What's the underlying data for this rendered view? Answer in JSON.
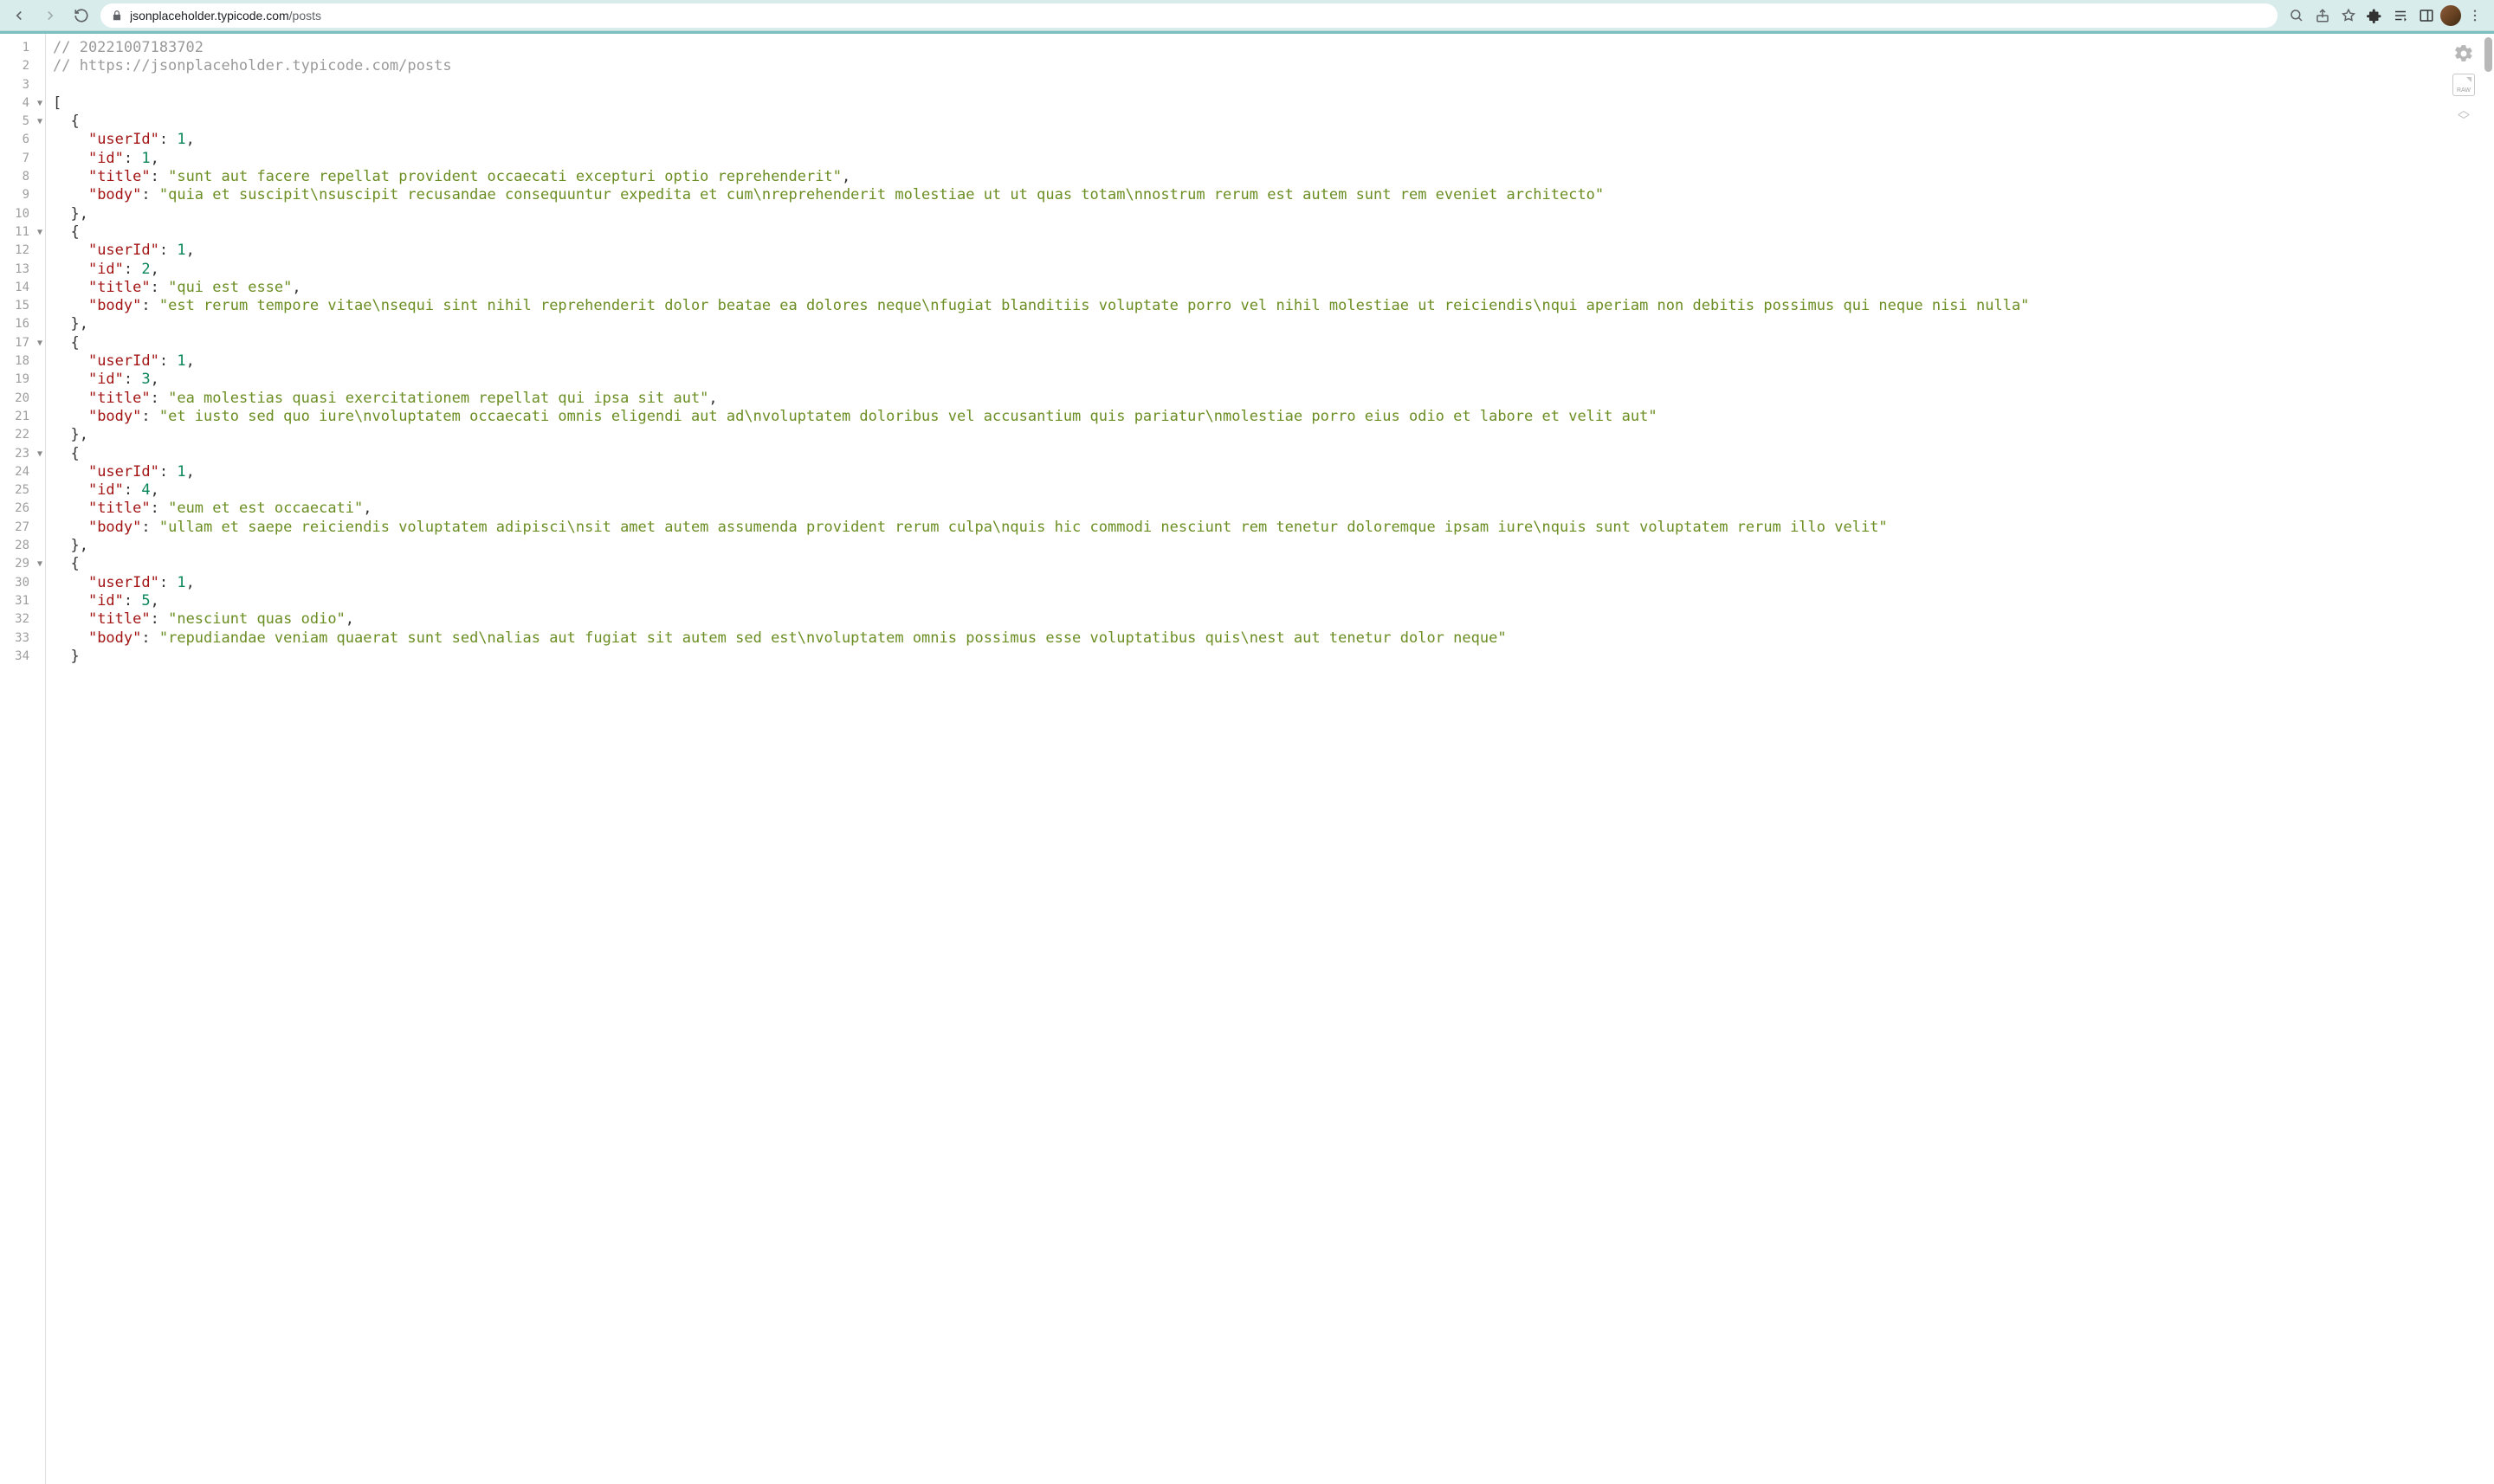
{
  "browser": {
    "url_host": "jsonplaceholder.typicode.com",
    "url_path": "/posts"
  },
  "code": {
    "comment_timestamp": "// 20221007183702",
    "comment_url": "// https://jsonplaceholder.typicode.com/posts",
    "posts": [
      {
        "userId": 1,
        "id": 1,
        "title": "sunt aut facere repellat provident occaecati excepturi optio reprehenderit",
        "body": "quia et suscipit\\nsuscipit recusandae consequuntur expedita et cum\\nreprehenderit molestiae ut ut quas totam\\nnostrum rerum est autem sunt rem eveniet architecto"
      },
      {
        "userId": 1,
        "id": 2,
        "title": "qui est esse",
        "body": "est rerum tempore vitae\\nsequi sint nihil reprehenderit dolor beatae ea dolores neque\\nfugiat blanditiis voluptate porro vel nihil molestiae ut reiciendis\\nqui aperiam non debitis possimus qui neque nisi nulla"
      },
      {
        "userId": 1,
        "id": 3,
        "title": "ea molestias quasi exercitationem repellat qui ipsa sit aut",
        "body": "et iusto sed quo iure\\nvoluptatem occaecati omnis eligendi aut ad\\nvoluptatem doloribus vel accusantium quis pariatur\\nmolestiae porro eius odio et labore et velit aut"
      },
      {
        "userId": 1,
        "id": 4,
        "title": "eum et est occaecati",
        "body": "ullam et saepe reiciendis voluptatem adipisci\\nsit amet autem assumenda provident rerum culpa\\nquis hic commodi nesciunt rem tenetur doloremque ipsam iure\\nquis sunt voluptatem rerum illo velit"
      },
      {
        "userId": 1,
        "id": 5,
        "title": "nesciunt quas odio",
        "body": "repudiandae veniam quaerat sunt sed\\nalias aut fugiat sit autem sed est\\nvoluptatem omnis possimus esse voluptatibus quis\\nest aut tenetur dolor neque"
      }
    ]
  },
  "raw_label": "RAW"
}
